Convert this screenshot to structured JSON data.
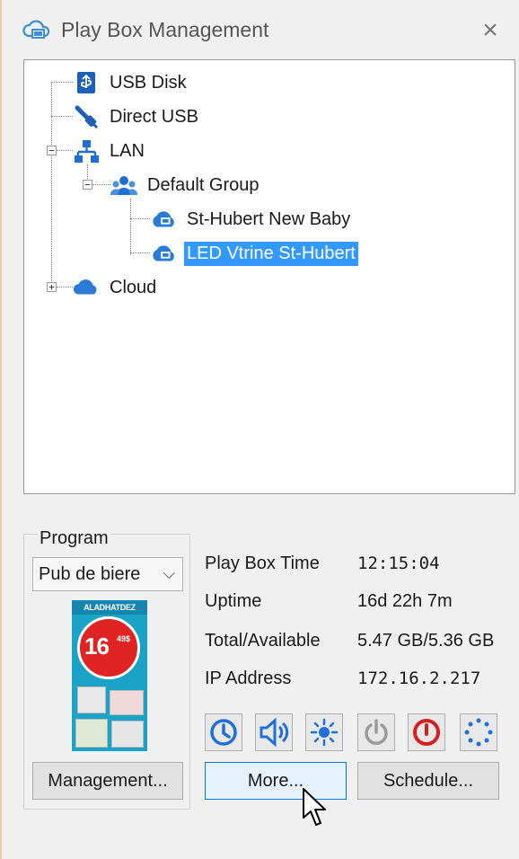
{
  "window": {
    "title": "Play Box Management",
    "close_symbol": "×",
    "title_icon": "cloud-device-icon"
  },
  "tree": {
    "items": [
      {
        "label": "USB Disk",
        "icon": "usb-disk-icon"
      },
      {
        "label": "Direct USB",
        "icon": "usb-cable-icon"
      },
      {
        "label": "LAN",
        "icon": "network-icon",
        "expanded": true
      },
      {
        "label": "Default Group",
        "icon": "group-icon",
        "expanded": true
      },
      {
        "label": "St-Hubert New Baby",
        "icon": "playbox-device-icon"
      },
      {
        "label": "LED Vtrine St-Hubert",
        "icon": "playbox-device-icon",
        "selected": true
      },
      {
        "label": "Cloud",
        "icon": "cloud-icon",
        "expanded": false
      }
    ],
    "expander_minus": "−",
    "expander_plus": "+"
  },
  "program": {
    "group_label": "Program",
    "selected": "Pub de biere",
    "dropdown_symbol": "⌵",
    "thumbnail": {
      "banner": "ALADHATDEZ",
      "price": "16",
      "cents": "49$"
    },
    "management_button": "Management..."
  },
  "info": {
    "play_box_time": {
      "label": "Play Box Time",
      "value": "12:15:04"
    },
    "uptime": {
      "label": "Uptime",
      "value": "16d 22h 7m"
    },
    "storage": {
      "label": "Total/Available",
      "value": "5.47 GB/5.36 GB"
    },
    "ip": {
      "label": "IP Address",
      "value": "172.16.2.217"
    }
  },
  "controls": {
    "icons": [
      "clock-icon",
      "volume-icon",
      "brightness-icon",
      "power-icon",
      "power-off-icon",
      "loading-icon"
    ],
    "colors": {
      "blue": "#1e6fd9",
      "red": "#d42020",
      "gray": "#9a9a9a",
      "selection": "#3399ff"
    }
  },
  "buttons": {
    "more": "More...",
    "schedule": "Schedule..."
  }
}
